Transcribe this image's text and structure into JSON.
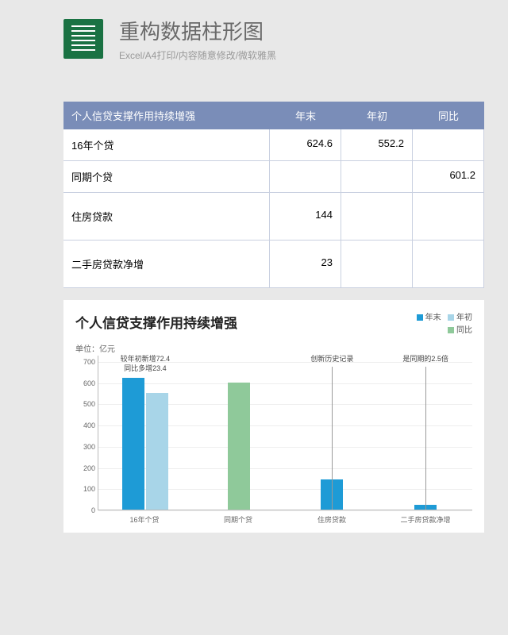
{
  "header": {
    "title": "重构数据柱形图",
    "subtitle": "Excel/A4打印/内容随意修改/微软雅黑",
    "icon": "excel-icon"
  },
  "table": {
    "header_label": "个人信贷支撑作用持续增强",
    "columns": [
      "年末",
      "年初",
      "同比"
    ],
    "rows": [
      {
        "label": "16年个贷",
        "year_end": "624.6",
        "year_start": "552.2",
        "yoy": ""
      },
      {
        "label": "同期个贷",
        "year_end": "",
        "year_start": "",
        "yoy": "601.2"
      },
      {
        "label": "住房贷款",
        "year_end": "144",
        "year_start": "",
        "yoy": ""
      },
      {
        "label": "二手房贷款净增",
        "year_end": "23",
        "year_start": "",
        "yoy": ""
      }
    ]
  },
  "chart_data": {
    "type": "bar",
    "title": "个人信贷支撑作用持续增强",
    "unit": "单位：亿元",
    "ylabel": "",
    "xlabel": "",
    "ylim": [
      0,
      730
    ],
    "y_ticks": [
      0,
      100,
      200,
      300,
      400,
      500,
      600,
      700
    ],
    "categories": [
      "16年个贷",
      "同期个贷",
      "住房贷款",
      "二手房贷款净增"
    ],
    "series": [
      {
        "name": "年末",
        "color": "#1e9bd6",
        "values": [
          624.6,
          null,
          144,
          23
        ]
      },
      {
        "name": "年初",
        "color": "#a8d5e8",
        "values": [
          552.2,
          null,
          null,
          null
        ]
      },
      {
        "name": "同比",
        "color": "#8fc99a",
        "values": [
          null,
          601.2,
          null,
          null
        ]
      }
    ],
    "annotations": [
      {
        "category": 0,
        "lines": [
          "较年初新增72.4",
          "同比多增23.4"
        ]
      },
      {
        "category": 2,
        "lines": [
          "创新历史记录"
        ],
        "leader_line": true
      },
      {
        "category": 3,
        "lines": [
          "是同期的2.5倍"
        ],
        "leader_line": true
      }
    ],
    "legend_position": "top-right"
  }
}
